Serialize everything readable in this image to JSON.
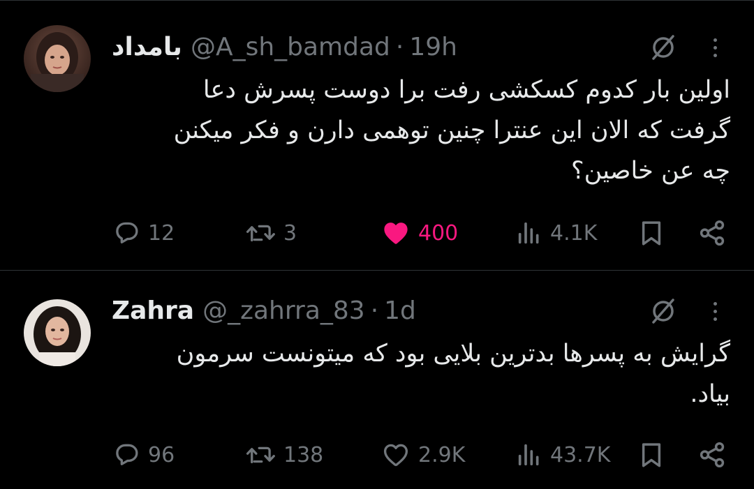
{
  "tweets": [
    {
      "display_name": "بامداد",
      "handle": "@A_sh_bamdad",
      "separator": "·",
      "time": "19h",
      "body_lines": [
        "اولین بار کدوم کسکشی رفت برا دوست پسرش دعا",
        "گرفت که الان این عنترا چنین توهمی دارن و فکر میکنن",
        "چه عن خاصین؟"
      ],
      "replies": "12",
      "retweets": "3",
      "likes": "400",
      "liked": true,
      "views": "4.1K",
      "avatar_icon": "avatar-photo"
    },
    {
      "display_name": "Zahra",
      "handle": "@_zahrra_83",
      "separator": "·",
      "time": "1d",
      "body_lines": [
        "گرایش به پسرها بدترین بلایی بود که میتونست سرمون",
        "بیاد."
      ],
      "replies": "96",
      "retweets": "138",
      "likes": "2.9K",
      "liked": false,
      "views": "43.7K",
      "avatar_icon": "avatar-photo"
    }
  ],
  "colors": {
    "background": "#000000",
    "text": "#e7e9ea",
    "muted": "#71767b",
    "like_active": "#f91880",
    "divider": "#2f3336"
  },
  "icons": [
    "reply-icon",
    "retweet-icon",
    "like-icon",
    "views-icon",
    "bookmark-icon",
    "share-icon",
    "grok-icon",
    "more-icon"
  ]
}
